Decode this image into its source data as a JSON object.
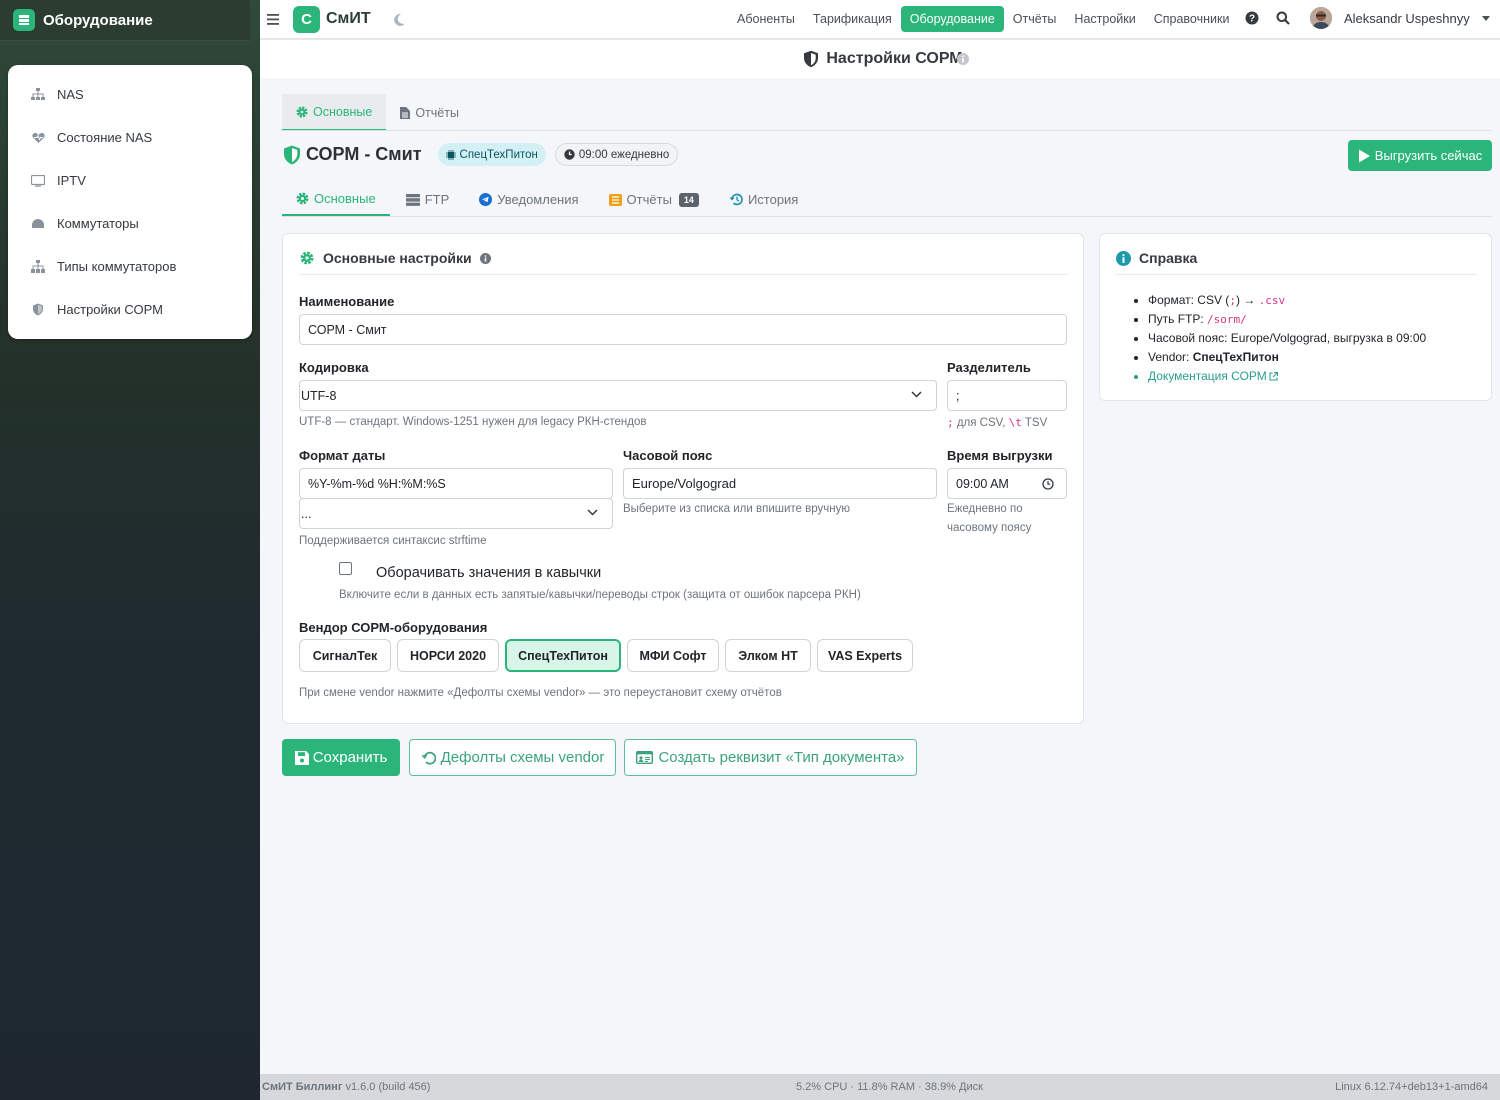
{
  "sidebar": {
    "brand": "Оборудование",
    "items": [
      {
        "label": "NAS",
        "icon": "network-icon"
      },
      {
        "label": "Состояние NAS",
        "icon": "heart-pulse-icon"
      },
      {
        "label": "IPTV",
        "icon": "tv-icon"
      },
      {
        "label": "Коммутаторы",
        "icon": "switch-icon"
      },
      {
        "label": "Типы коммутаторов",
        "icon": "sitemap-icon"
      },
      {
        "label": "Настройки СОРМ",
        "icon": "shield-icon"
      }
    ]
  },
  "topbar": {
    "logo_letter": "С",
    "logo_text": "СмИТ",
    "nav": [
      "Абоненты",
      "Тарификация",
      "Оборудование",
      "Отчёты",
      "Настройки",
      "Справочники"
    ],
    "active_nav": "Оборудование",
    "user_name": "Aleksandr Uspeshnyy"
  },
  "page": {
    "title": "Настройки СОРМ"
  },
  "tabs_top": [
    {
      "label": "Основные",
      "icon": "gear-icon",
      "active": true
    },
    {
      "label": "Отчёты",
      "icon": "file-icon",
      "active": false
    }
  ],
  "sorm": {
    "title": "СОРМ - Смит",
    "vendor_badge": "СпецТехПитон",
    "schedule_badge": "09:00 ежедневно",
    "export_button": "Выгрузить сейчас"
  },
  "tabs_sub": [
    {
      "label": "Основные",
      "icon": "gear-icon",
      "active": true
    },
    {
      "label": "FTP",
      "icon": "server-icon",
      "active": false
    },
    {
      "label": "Уведомления",
      "icon": "telegram-icon",
      "active": false
    },
    {
      "label": "Отчёты",
      "icon": "list-icon",
      "active": false,
      "count": "14"
    },
    {
      "label": "История",
      "icon": "history-icon",
      "active": false
    }
  ],
  "form": {
    "section_title": "Основные настройки",
    "name_label": "Наименование",
    "name_value": "СОРМ - Смит",
    "encoding_label": "Кодировка",
    "encoding_value": "UTF-8",
    "encoding_help": "UTF-8 — стандарт. Windows-1251 нужен для legacy РКН-стендов",
    "separator_label": "Разделитель",
    "separator_value": ";",
    "separator_help_code1": ";",
    "separator_help_text1": " для CSV, ",
    "separator_help_code2": "\\t",
    "separator_help_text2": " TSV",
    "date_format_label": "Формат даты",
    "date_format_value": "%Y-%m-%d %H:%M:%S",
    "date_format_preset": "...",
    "date_format_help": "Поддерживается синтаксис strftime",
    "timezone_label": "Часовой пояс",
    "timezone_value": "Europe/Volgograd",
    "timezone_help": "Выберите из списка или впишите вручную",
    "export_time_label": "Время выгрузки",
    "export_time_value": "09:00 AM",
    "export_time_help_1": "Ежедневно по",
    "export_time_help_2": "часовому поясу",
    "quote_label": "Оборачивать значения в кавычки",
    "quote_checked": false,
    "quote_help": "Включите если в данных есть запятые/кавычки/переводы строк (защита от ошибок парсера РКН)",
    "vendor_label": "Вендор СОРМ-оборудования",
    "vendors": [
      "СигналТек",
      "НОРСИ 2020",
      "СпецТехПитон",
      "МФИ Софт",
      "Элком НТ",
      "VAS Experts"
    ],
    "active_vendor": "СпецТехПитон",
    "vendor_help": "При смене vendor нажмите «Дефолты схемы vendor» — это переустановит схему отчётов"
  },
  "help": {
    "title": "Справка",
    "format_prefix": "Формат: CSV (",
    "format_code1": ";",
    "format_mid": ") → ",
    "format_code2": ".csv",
    "ftp_prefix": "Путь FTP: ",
    "ftp_code": "/sorm/",
    "tz_line": "Часовой пояс: Europe/Volgograd, выгрузка в 09:00",
    "vendor_prefix": "Vendor: ",
    "vendor_value": "СпецТехПитон",
    "docs_link": "Документация СОРМ"
  },
  "actions": {
    "save": "Сохранить",
    "defaults": "Дефолты схемы vendor",
    "create_requisite": "Создать реквизит «Тип документа»"
  },
  "footer": {
    "app_name": "СмИТ Биллинг",
    "version": " v1.6.0 (build 456)",
    "stats": "5.2% CPU · 11.8% RAM · 38.9% Диск",
    "kernel": "Linux 6.12.74+deb13+1-amd64"
  },
  "colors": {
    "accent": "#2bb57a",
    "sidebar_dark": "#1f2a30"
  }
}
